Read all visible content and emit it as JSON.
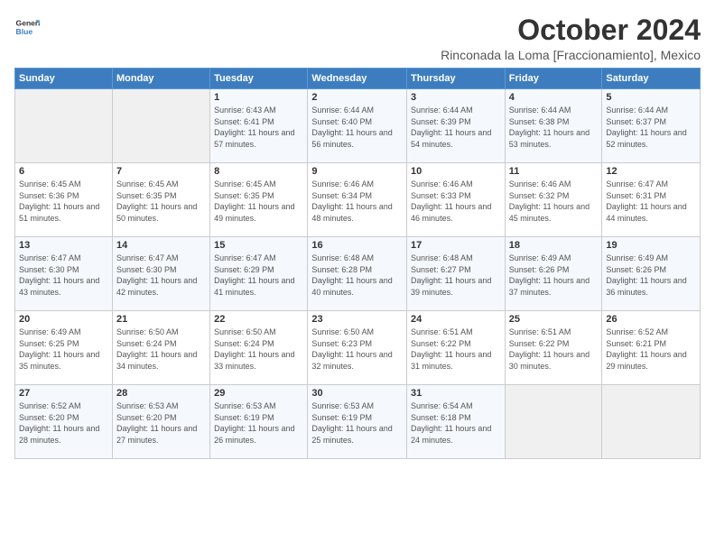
{
  "header": {
    "logo_line1": "General",
    "logo_line2": "Blue",
    "month": "October 2024",
    "location": "Rinconada la Loma [Fraccionamiento], Mexico"
  },
  "weekdays": [
    "Sunday",
    "Monday",
    "Tuesday",
    "Wednesday",
    "Thursday",
    "Friday",
    "Saturday"
  ],
  "weeks": [
    [
      {
        "day": "",
        "info": ""
      },
      {
        "day": "",
        "info": ""
      },
      {
        "day": "1",
        "info": "Sunrise: 6:43 AM\nSunset: 6:41 PM\nDaylight: 11 hours and 57 minutes."
      },
      {
        "day": "2",
        "info": "Sunrise: 6:44 AM\nSunset: 6:40 PM\nDaylight: 11 hours and 56 minutes."
      },
      {
        "day": "3",
        "info": "Sunrise: 6:44 AM\nSunset: 6:39 PM\nDaylight: 11 hours and 54 minutes."
      },
      {
        "day": "4",
        "info": "Sunrise: 6:44 AM\nSunset: 6:38 PM\nDaylight: 11 hours and 53 minutes."
      },
      {
        "day": "5",
        "info": "Sunrise: 6:44 AM\nSunset: 6:37 PM\nDaylight: 11 hours and 52 minutes."
      }
    ],
    [
      {
        "day": "6",
        "info": "Sunrise: 6:45 AM\nSunset: 6:36 PM\nDaylight: 11 hours and 51 minutes."
      },
      {
        "day": "7",
        "info": "Sunrise: 6:45 AM\nSunset: 6:35 PM\nDaylight: 11 hours and 50 minutes."
      },
      {
        "day": "8",
        "info": "Sunrise: 6:45 AM\nSunset: 6:35 PM\nDaylight: 11 hours and 49 minutes."
      },
      {
        "day": "9",
        "info": "Sunrise: 6:46 AM\nSunset: 6:34 PM\nDaylight: 11 hours and 48 minutes."
      },
      {
        "day": "10",
        "info": "Sunrise: 6:46 AM\nSunset: 6:33 PM\nDaylight: 11 hours and 46 minutes."
      },
      {
        "day": "11",
        "info": "Sunrise: 6:46 AM\nSunset: 6:32 PM\nDaylight: 11 hours and 45 minutes."
      },
      {
        "day": "12",
        "info": "Sunrise: 6:47 AM\nSunset: 6:31 PM\nDaylight: 11 hours and 44 minutes."
      }
    ],
    [
      {
        "day": "13",
        "info": "Sunrise: 6:47 AM\nSunset: 6:30 PM\nDaylight: 11 hours and 43 minutes."
      },
      {
        "day": "14",
        "info": "Sunrise: 6:47 AM\nSunset: 6:30 PM\nDaylight: 11 hours and 42 minutes."
      },
      {
        "day": "15",
        "info": "Sunrise: 6:47 AM\nSunset: 6:29 PM\nDaylight: 11 hours and 41 minutes."
      },
      {
        "day": "16",
        "info": "Sunrise: 6:48 AM\nSunset: 6:28 PM\nDaylight: 11 hours and 40 minutes."
      },
      {
        "day": "17",
        "info": "Sunrise: 6:48 AM\nSunset: 6:27 PM\nDaylight: 11 hours and 39 minutes."
      },
      {
        "day": "18",
        "info": "Sunrise: 6:49 AM\nSunset: 6:26 PM\nDaylight: 11 hours and 37 minutes."
      },
      {
        "day": "19",
        "info": "Sunrise: 6:49 AM\nSunset: 6:26 PM\nDaylight: 11 hours and 36 minutes."
      }
    ],
    [
      {
        "day": "20",
        "info": "Sunrise: 6:49 AM\nSunset: 6:25 PM\nDaylight: 11 hours and 35 minutes."
      },
      {
        "day": "21",
        "info": "Sunrise: 6:50 AM\nSunset: 6:24 PM\nDaylight: 11 hours and 34 minutes."
      },
      {
        "day": "22",
        "info": "Sunrise: 6:50 AM\nSunset: 6:24 PM\nDaylight: 11 hours and 33 minutes."
      },
      {
        "day": "23",
        "info": "Sunrise: 6:50 AM\nSunset: 6:23 PM\nDaylight: 11 hours and 32 minutes."
      },
      {
        "day": "24",
        "info": "Sunrise: 6:51 AM\nSunset: 6:22 PM\nDaylight: 11 hours and 31 minutes."
      },
      {
        "day": "25",
        "info": "Sunrise: 6:51 AM\nSunset: 6:22 PM\nDaylight: 11 hours and 30 minutes."
      },
      {
        "day": "26",
        "info": "Sunrise: 6:52 AM\nSunset: 6:21 PM\nDaylight: 11 hours and 29 minutes."
      }
    ],
    [
      {
        "day": "27",
        "info": "Sunrise: 6:52 AM\nSunset: 6:20 PM\nDaylight: 11 hours and 28 minutes."
      },
      {
        "day": "28",
        "info": "Sunrise: 6:53 AM\nSunset: 6:20 PM\nDaylight: 11 hours and 27 minutes."
      },
      {
        "day": "29",
        "info": "Sunrise: 6:53 AM\nSunset: 6:19 PM\nDaylight: 11 hours and 26 minutes."
      },
      {
        "day": "30",
        "info": "Sunrise: 6:53 AM\nSunset: 6:19 PM\nDaylight: 11 hours and 25 minutes."
      },
      {
        "day": "31",
        "info": "Sunrise: 6:54 AM\nSunset: 6:18 PM\nDaylight: 11 hours and 24 minutes."
      },
      {
        "day": "",
        "info": ""
      },
      {
        "day": "",
        "info": ""
      }
    ]
  ]
}
